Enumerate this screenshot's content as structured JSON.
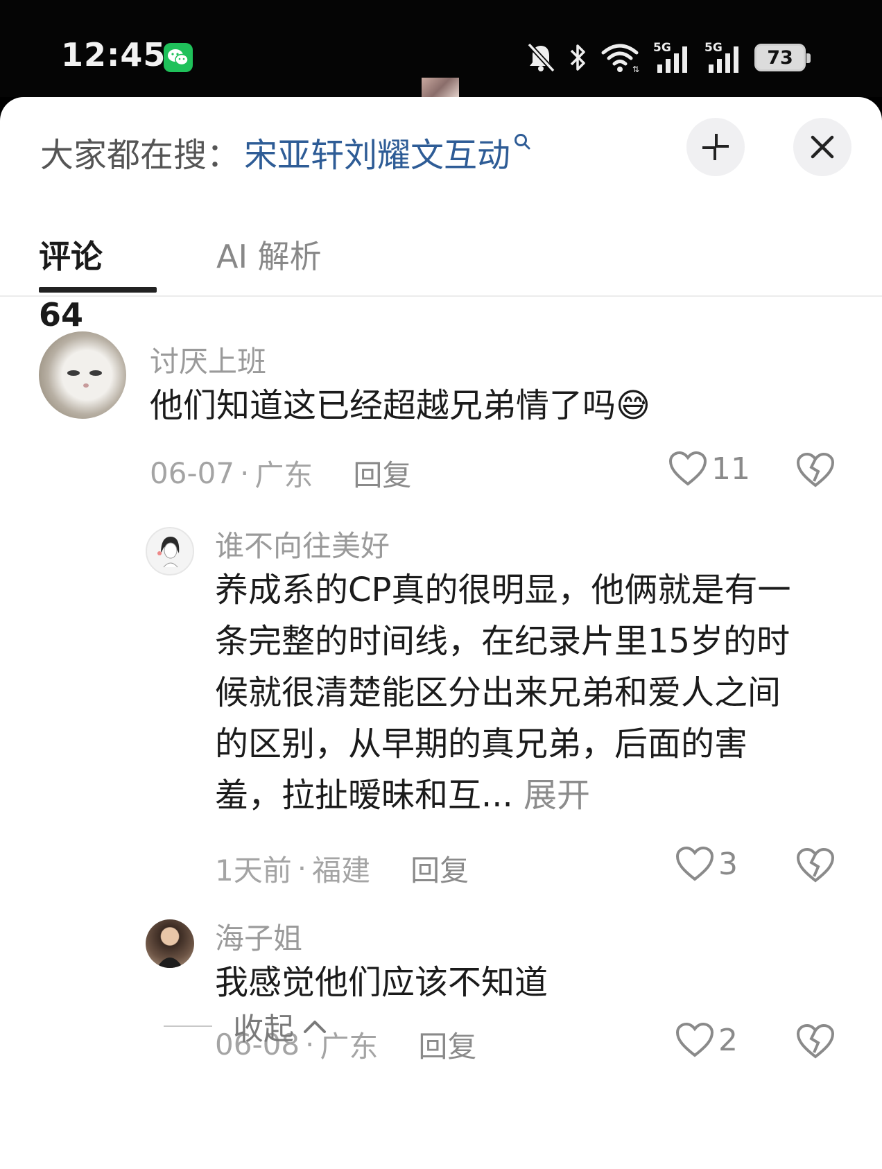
{
  "status_bar": {
    "time": "12:45",
    "battery": "73",
    "signal_labels": [
      "5G",
      "5G"
    ],
    "icons": [
      "wechat-icon",
      "mute-bell-icon",
      "bluetooth-icon",
      "wifi-icon",
      "signal-5g-icon",
      "signal-5g-icon",
      "battery-icon"
    ]
  },
  "search_bar": {
    "prefix": "大家都在搜：",
    "query": "宋亚轩刘耀文互动"
  },
  "tabs": [
    {
      "label": "评论 64",
      "active": true
    },
    {
      "label": "AI 解析",
      "active": false
    }
  ],
  "comments": [
    {
      "username": "讨厌上班",
      "text": "他们知道这已经超越兄弟情了吗",
      "emoji": "😅",
      "date": "06-07",
      "location": "广东",
      "reply_label": "回复",
      "likes": "11"
    },
    {
      "username": "谁不向往美好",
      "lines": [
        "养成系的CP真的很明显，他俩就是有一",
        "条完整的时间线，在纪录片里15岁的时",
        "候就很清楚能区分出来兄弟和爱人之间",
        "的区别，从早期的真兄弟，后面的害",
        "羞，拉扯暧昧和互..."
      ],
      "expand_label": "展开",
      "date": "1天前",
      "location": "福建",
      "reply_label": "回复",
      "likes": "3"
    },
    {
      "username": "海子姐",
      "text": "我感觉他们应该不知道",
      "date": "06-08",
      "location": "广东",
      "reply_label": "回复",
      "likes": "2"
    }
  ],
  "collapse_label": "收起",
  "colors": {
    "query_blue": "#2e5c96",
    "muted_text": "#9a9a9a",
    "body_text": "#1b1b1b",
    "wechat_green": "#1fc15a"
  }
}
